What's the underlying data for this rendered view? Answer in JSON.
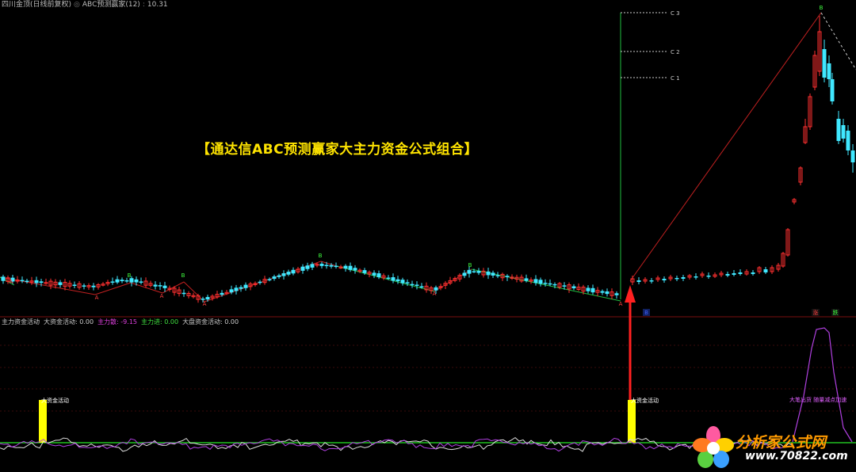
{
  "window": {
    "title": "四川金顶(日线前复权)",
    "formula": "ABC预测赢家(12)",
    "value": "10.31"
  },
  "headline": "【通达信ABC预测赢家大主力资金公式组合】",
  "indicator": {
    "items": [
      {
        "text": "主力资金活动",
        "color": "#cccccc"
      },
      {
        "text": "大资金活动: 0.00",
        "color": "#cccccc"
      },
      {
        "text": "主力散: -9.15",
        "color": "#e040e0"
      },
      {
        "text": "主力进: 0.00",
        "color": "#40e040"
      },
      {
        "text": "大盘资金活动: 0.00",
        "color": "#cccccc"
      }
    ]
  },
  "watermark": {
    "cn": "分析家公式网",
    "url": "www.70822.com"
  },
  "chart_data": {
    "type": "candlestick",
    "markers_A": [
      "A",
      "A",
      "A",
      "A",
      "A",
      "A",
      "A"
    ],
    "markers_B": [
      "B",
      "B",
      "B",
      "B",
      "B"
    ],
    "targets": [
      {
        "label": "C 3"
      },
      {
        "label": "C 2"
      },
      {
        "label": "C 1"
      }
    ],
    "event_labels": [
      {
        "text": "大资金活动"
      },
      {
        "text": "大资金活动"
      },
      {
        "text": "大笔出货 随量减点加速"
      }
    ],
    "top_tags": [
      {
        "text": "涨",
        "color": "#ff4040"
      },
      {
        "text": "跌",
        "color": "#40ff40"
      }
    ],
    "bottom_tag": {
      "text": "B",
      "color": "#4060ff"
    },
    "colors": {
      "up": "#ff3030",
      "down": "#40e8ff",
      "trend_red": "#c02020",
      "trend_green": "#20c040",
      "volume_bar": "#ffff00",
      "oscillator_white": "#dddddd",
      "oscillator_purple": "#b040e0",
      "baseline": "#20c020"
    }
  }
}
